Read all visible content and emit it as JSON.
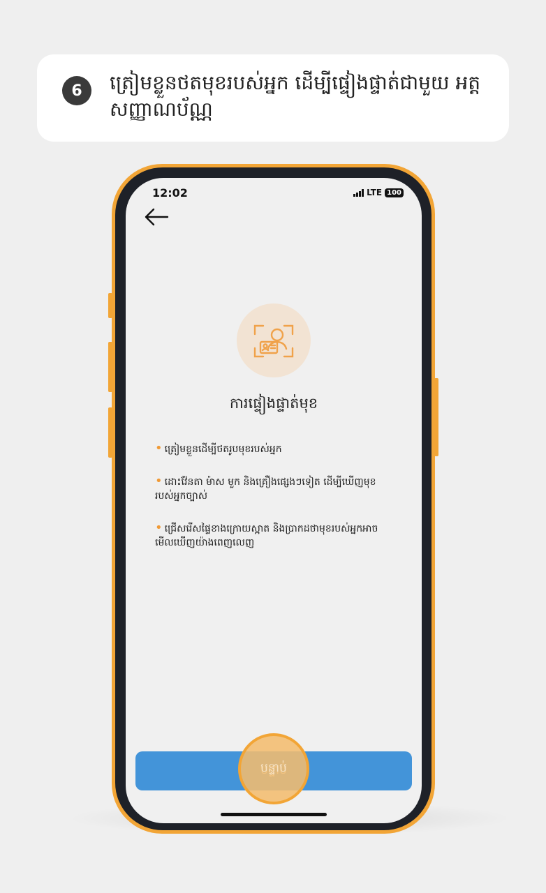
{
  "step": {
    "number": "6",
    "text": "ត្រៀមខ្លួនថតមុខរបស់អ្នក ដើម្បីផ្ទៀងផ្ទាត់ជាមួយ អត្តសញ្ញាណប័ណ្ណ"
  },
  "status_bar": {
    "time": "12:02",
    "network": "LTE",
    "battery": "100"
  },
  "face_verify": {
    "icon": "face-scan-icon",
    "title": "ការផ្ទៀងផ្ទាត់មុខ",
    "bullets": [
      "ត្រៀមខ្លួនដើម្បីថតរូបមុខរបស់អ្នក",
      "ដោះវ៉ែនតា ម៉ាស មួក និងគ្រឿងផ្សេងៗទៀត ដើម្បីឃើញមុខរបស់អ្នកច្បាស់",
      "ជ្រើសរើសផ្ទៃខាងក្រោយស្អាត និងប្រាកដថាមុខរបស់អ្នកអាចមើលឃើញយ៉ាងពេញលេញ"
    ]
  },
  "next_button": {
    "label": "បន្ទាប់"
  },
  "colors": {
    "accent": "#f2a536",
    "button": "#4394d9",
    "bullet": "#f09a36"
  }
}
